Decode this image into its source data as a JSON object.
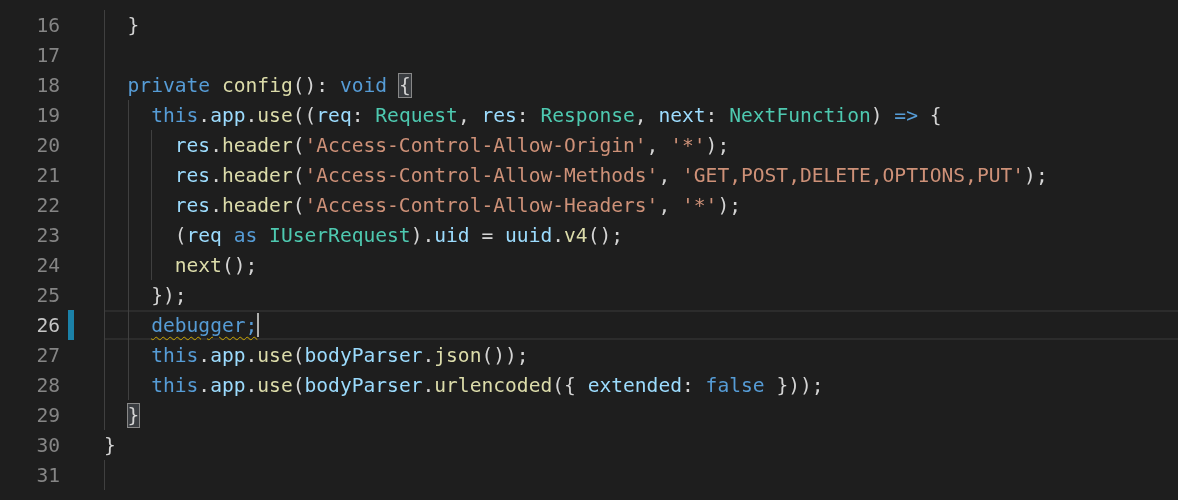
{
  "editor": {
    "lines": [
      {
        "number": "16",
        "modified": false,
        "current": false,
        "cursor": false,
        "tokens": [
          {
            "text": "  }",
            "kind": "plain"
          }
        ]
      },
      {
        "number": "17",
        "modified": false,
        "current": false,
        "cursor": false
      },
      {
        "number": "18",
        "modified": false,
        "current": false,
        "cursor": false,
        "tokens": [
          {
            "text": "  private ",
            "kind": "kw"
          },
          {
            "text": "config",
            "kind": "fn"
          },
          {
            "text": "(): ",
            "kind": "plain"
          },
          {
            "text": "void ",
            "kind": "kw"
          },
          {
            "text": "{",
            "kind": "plain",
            "matched": true
          }
        ]
      },
      {
        "number": "19",
        "modified": false,
        "current": false,
        "cursor": false,
        "tokens": [
          {
            "text": "    this",
            "kind": "kw"
          },
          {
            "text": ".",
            "kind": "plain"
          },
          {
            "text": "app",
            "kind": "var"
          },
          {
            "text": ".",
            "kind": "plain"
          },
          {
            "text": "use",
            "kind": "fn"
          },
          {
            "text": "((",
            "kind": "plain"
          },
          {
            "text": "req",
            "kind": "var"
          },
          {
            "text": ": ",
            "kind": "plain"
          },
          {
            "text": "Request",
            "kind": "type"
          },
          {
            "text": ", ",
            "kind": "plain"
          },
          {
            "text": "res",
            "kind": "var"
          },
          {
            "text": ": ",
            "kind": "plain"
          },
          {
            "text": "Response",
            "kind": "type"
          },
          {
            "text": ", ",
            "kind": "plain"
          },
          {
            "text": "next",
            "kind": "var"
          },
          {
            "text": ": ",
            "kind": "plain"
          },
          {
            "text": "NextFunction",
            "kind": "type"
          },
          {
            "text": ") ",
            "kind": "plain"
          },
          {
            "text": "=>",
            "kind": "kw"
          },
          {
            "text": " {",
            "kind": "plain"
          }
        ]
      },
      {
        "number": "20",
        "modified": false,
        "current": false,
        "cursor": false,
        "tokens": [
          {
            "text": "      res",
            "kind": "var"
          },
          {
            "text": ".",
            "kind": "plain"
          },
          {
            "text": "header",
            "kind": "fn"
          },
          {
            "text": "(",
            "kind": "plain"
          },
          {
            "text": "'Access-Control-Allow-Origin'",
            "kind": "str"
          },
          {
            "text": ", ",
            "kind": "plain"
          },
          {
            "text": "'*'",
            "kind": "str"
          },
          {
            "text": ");",
            "kind": "plain"
          }
        ]
      },
      {
        "number": "21",
        "modified": false,
        "current": false,
        "cursor": false,
        "tokens": [
          {
            "text": "      res",
            "kind": "var"
          },
          {
            "text": ".",
            "kind": "plain"
          },
          {
            "text": "header",
            "kind": "fn"
          },
          {
            "text": "(",
            "kind": "plain"
          },
          {
            "text": "'Access-Control-Allow-Methods'",
            "kind": "str"
          },
          {
            "text": ", ",
            "kind": "plain"
          },
          {
            "text": "'GET,POST,DELETE,OPTIONS,PUT'",
            "kind": "str"
          },
          {
            "text": ");",
            "kind": "plain"
          }
        ]
      },
      {
        "number": "22",
        "modified": false,
        "current": false,
        "cursor": false,
        "tokens": [
          {
            "text": "      res",
            "kind": "var"
          },
          {
            "text": ".",
            "kind": "plain"
          },
          {
            "text": "header",
            "kind": "fn"
          },
          {
            "text": "(",
            "kind": "plain"
          },
          {
            "text": "'Access-Control-Allow-Headers'",
            "kind": "str"
          },
          {
            "text": ", ",
            "kind": "plain"
          },
          {
            "text": "'*'",
            "kind": "str"
          },
          {
            "text": ");",
            "kind": "plain"
          }
        ]
      },
      {
        "number": "23",
        "modified": false,
        "current": false,
        "cursor": false,
        "tokens": [
          {
            "text": "      (",
            "kind": "plain"
          },
          {
            "text": "req ",
            "kind": "var"
          },
          {
            "text": "as ",
            "kind": "kw"
          },
          {
            "text": "IUserRequest",
            "kind": "type"
          },
          {
            "text": ").",
            "kind": "plain"
          },
          {
            "text": "uid",
            "kind": "var"
          },
          {
            "text": " = ",
            "kind": "plain"
          },
          {
            "text": "uuid",
            "kind": "var"
          },
          {
            "text": ".",
            "kind": "plain"
          },
          {
            "text": "v4",
            "kind": "fn"
          },
          {
            "text": "();",
            "kind": "plain"
          }
        ]
      },
      {
        "number": "24",
        "modified": false,
        "current": false,
        "cursor": false,
        "tokens": [
          {
            "text": "      next",
            "kind": "fn"
          },
          {
            "text": "();",
            "kind": "plain"
          }
        ]
      },
      {
        "number": "25",
        "modified": false,
        "current": false,
        "cursor": false,
        "tokens": [
          {
            "text": "    });",
            "kind": "plain"
          }
        ]
      },
      {
        "number": "26",
        "modified": true,
        "current": true,
        "cursor": true,
        "tokens": [
          {
            "text": "    debugger;",
            "kind": "kw",
            "warning": true
          }
        ]
      },
      {
        "number": "27",
        "modified": false,
        "current": false,
        "cursor": false,
        "tokens": [
          {
            "text": "    this",
            "kind": "kw"
          },
          {
            "text": ".",
            "kind": "plain"
          },
          {
            "text": "app",
            "kind": "var"
          },
          {
            "text": ".",
            "kind": "plain"
          },
          {
            "text": "use",
            "kind": "fn"
          },
          {
            "text": "(",
            "kind": "plain"
          },
          {
            "text": "bodyParser",
            "kind": "var"
          },
          {
            "text": ".",
            "kind": "plain"
          },
          {
            "text": "json",
            "kind": "fn"
          },
          {
            "text": "());",
            "kind": "plain"
          }
        ]
      },
      {
        "number": "28",
        "modified": false,
        "current": false,
        "cursor": false,
        "tokens": [
          {
            "text": "    this",
            "kind": "kw"
          },
          {
            "text": ".",
            "kind": "plain"
          },
          {
            "text": "app",
            "kind": "var"
          },
          {
            "text": ".",
            "kind": "plain"
          },
          {
            "text": "use",
            "kind": "fn"
          },
          {
            "text": "(",
            "kind": "plain"
          },
          {
            "text": "bodyParser",
            "kind": "var"
          },
          {
            "text": ".",
            "kind": "plain"
          },
          {
            "text": "urlencoded",
            "kind": "fn"
          },
          {
            "text": "({ ",
            "kind": "plain"
          },
          {
            "text": "extended",
            "kind": "var"
          },
          {
            "text": ": ",
            "kind": "plain"
          },
          {
            "text": "false",
            "kind": "kw"
          },
          {
            "text": " }));",
            "kind": "plain"
          }
        ]
      },
      {
        "number": "29",
        "modified": false,
        "current": false,
        "cursor": false,
        "tokens": [
          {
            "text": "  }",
            "kind": "plain",
            "matched": true
          }
        ]
      },
      {
        "number": "30",
        "modified": false,
        "current": false,
        "cursor": false,
        "tokens": [
          {
            "text": "}",
            "kind": "plain"
          }
        ]
      },
      {
        "number": "31",
        "modified": false,
        "current": false,
        "cursor": false
      }
    ]
  }
}
